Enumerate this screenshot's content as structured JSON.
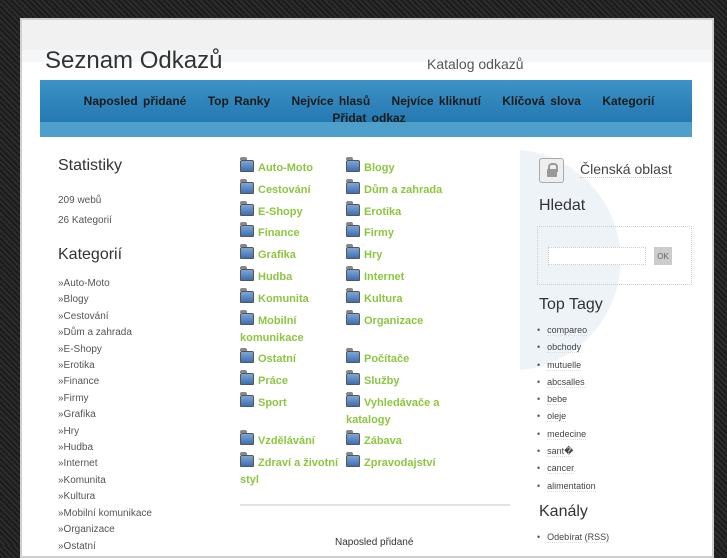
{
  "header": {
    "title": "Seznam Odkazů",
    "subtitle": "Katalog odkazů"
  },
  "nav": [
    "Naposled přidané",
    "Top Ranky",
    "Nejvíce hlasů",
    "Nejvíce kliknutí",
    "Klíčová slova",
    "Kategorií",
    "Přidat odkaz"
  ],
  "stats": {
    "heading": "Statistiky",
    "sites": "209 webů",
    "categories": "26 Kategorií"
  },
  "cat_sidebar": {
    "heading": "Kategorií",
    "items": [
      "»Auto-Moto",
      "»Blogy",
      "»Cestování",
      "»Dům a zahrada",
      "»E-Shopy",
      "»Erotika",
      "»Finance",
      "»Firmy",
      "»Grafika",
      "»Hry",
      "»Hudba",
      "»Internet",
      "»Komunita",
      "»Kultura",
      "»Mobilní komunikace",
      "»Organizace",
      "»Ostatní"
    ]
  },
  "categories_col1": [
    "Auto-Moto",
    "Cestování",
    "E-Shopy",
    "Finance",
    "Grafika",
    "Hudba",
    "Komunita",
    "Mobilní komunikace",
    "Ostatní",
    "Práce",
    "Sport",
    "Vzdělávání",
    "Zdraví a životní styl"
  ],
  "categories_col2": [
    "Blogy",
    "Dům a zahrada",
    "Erotika",
    "Firmy",
    "Hry",
    "Internet",
    "Kultura",
    "Organizace",
    "Počítače",
    "Služby",
    "Vyhledávače a katalogy",
    "Zábava",
    "Zpravodajství"
  ],
  "recent_heading": "Naposled přidané",
  "sidebar": {
    "member": "Členská oblast",
    "search_heading": "Hledat",
    "search_value": "",
    "ok": "OK",
    "tags_heading": "Top Tagy",
    "tags": [
      "compareo",
      "obchody",
      "mutuelle",
      "abcsalles",
      "bebe",
      "oleje",
      "medecine",
      "sant�",
      "cancer",
      "alimentation"
    ],
    "channels_heading": "Kanály",
    "channels": [
      "Odebírat (RSS)"
    ]
  }
}
